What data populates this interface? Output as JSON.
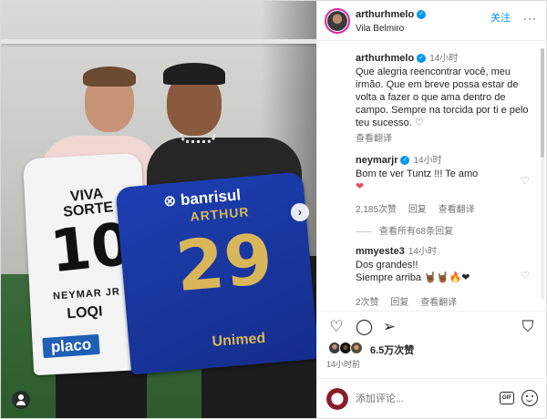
{
  "header": {
    "username": "arthurhmelo",
    "location": "Vila Belmiro",
    "follow_label": "关注",
    "more_label": "···"
  },
  "caption": {
    "username": "arthurhmelo",
    "time": "14小时",
    "text": "Que alegria reencontrar você, meu irmão. Que em breve possa estar de volta a fazer o que ama dentro de campo. Sempre na torcida por ti e pelo teu sucesso. ♡",
    "translate_label": "查看翻译"
  },
  "comments": [
    {
      "username": "neymarjr",
      "time": "14小时",
      "text": "Bom te ver Tuntz !!! Te amo",
      "emoji": "❤",
      "likes": "2,185次赞",
      "reply_label": "回复",
      "translate_label": "查看翻译",
      "view_replies": "查看所有68条回复"
    },
    {
      "username": "mmyeste3",
      "time": "14小时",
      "text_line1": "Dos grandes!!",
      "text_line2": "Siempre arriba",
      "emoji": "🤘🏾🤘🏾🔥❤",
      "likes": "2次赞",
      "reply_label": "回复",
      "translate_label": "查看翻译"
    }
  ],
  "actions": {
    "like_icon": "♡",
    "comment_icon": "◯",
    "share_icon": "➢",
    "save_icon": "⛉"
  },
  "likes_text": "6.5万次赞",
  "post_time": "14小时前",
  "add_comment": {
    "placeholder": "添加评论...",
    "gif_label": "GIF"
  },
  "media": {
    "white_jersey": {
      "sponsor": "VIVA SORTE",
      "number": "10",
      "name": "NEYMAR JR",
      "logo": "LOQI",
      "brand": "placo"
    },
    "blue_jersey": {
      "sponsor": "⊗ banrisul",
      "name": "ARTHUR",
      "number": "29",
      "brand": "Unimed"
    },
    "next_icon": "›"
  },
  "colors": {
    "accent": "#0095f6",
    "like_red": "#ed4956",
    "text": "#262626",
    "muted": "#737373"
  }
}
